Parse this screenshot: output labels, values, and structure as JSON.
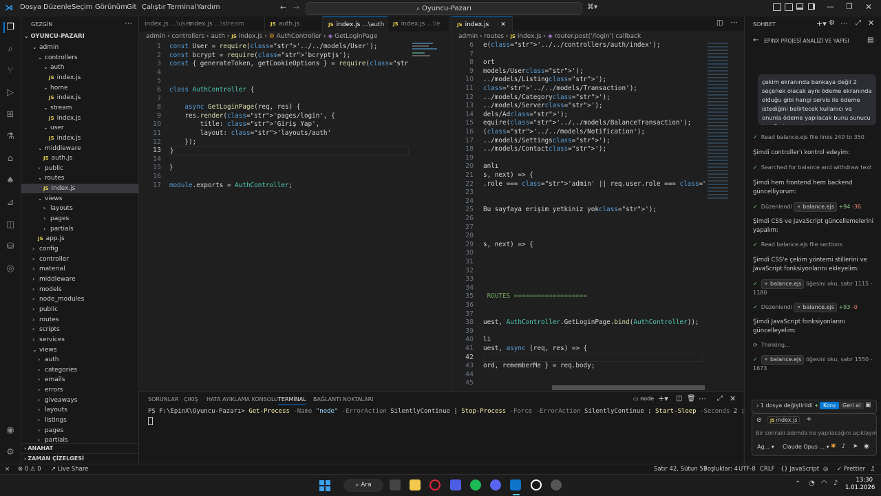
{
  "titlebar": {
    "menu": [
      "Dosya",
      "Düzenle",
      "Seçim",
      "Görünüm",
      "Git",
      "Çalıştır",
      "Terminal",
      "Yardım"
    ],
    "search_text": "Oyuncu-Pazarı"
  },
  "sidebar": {
    "header": "GEZGİN",
    "root": "OYUNCU-PAZARI",
    "tree": [
      {
        "label": "admin",
        "depth": 1,
        "type": "folder-open"
      },
      {
        "label": "controllers",
        "depth": 2,
        "type": "folder-open"
      },
      {
        "label": "auth",
        "depth": 3,
        "type": "folder-open"
      },
      {
        "label": "index.js",
        "depth": 4,
        "type": "file"
      },
      {
        "label": "home",
        "depth": 3,
        "type": "folder-open"
      },
      {
        "label": "index.js",
        "depth": 4,
        "type": "file"
      },
      {
        "label": "stream",
        "depth": 3,
        "type": "folder-open"
      },
      {
        "label": "index.js",
        "depth": 4,
        "type": "file"
      },
      {
        "label": "user",
        "depth": 3,
        "type": "folder-open"
      },
      {
        "label": "index.js",
        "depth": 4,
        "type": "file"
      },
      {
        "label": "middleware",
        "depth": 2,
        "type": "folder-open"
      },
      {
        "label": "auth.js",
        "depth": 3,
        "type": "file"
      },
      {
        "label": "public",
        "depth": 2,
        "type": "folder"
      },
      {
        "label": "routes",
        "depth": 2,
        "type": "folder-open"
      },
      {
        "label": "index.js",
        "depth": 3,
        "type": "file",
        "selected": true
      },
      {
        "label": "views",
        "depth": 2,
        "type": "folder-open"
      },
      {
        "label": "layouts",
        "depth": 3,
        "type": "folder"
      },
      {
        "label": "pages",
        "depth": 3,
        "type": "folder"
      },
      {
        "label": "partials",
        "depth": 3,
        "type": "folder"
      },
      {
        "label": "app.js",
        "depth": 2,
        "type": "file"
      },
      {
        "label": "config",
        "depth": 1,
        "type": "folder"
      },
      {
        "label": "controller",
        "depth": 1,
        "type": "folder"
      },
      {
        "label": "material",
        "depth": 1,
        "type": "folder"
      },
      {
        "label": "middleware",
        "depth": 1,
        "type": "folder"
      },
      {
        "label": "models",
        "depth": 1,
        "type": "folder"
      },
      {
        "label": "node_modules",
        "depth": 1,
        "type": "folder"
      },
      {
        "label": "public",
        "depth": 1,
        "type": "folder"
      },
      {
        "label": "routes",
        "depth": 1,
        "type": "folder"
      },
      {
        "label": "scripts",
        "depth": 1,
        "type": "folder"
      },
      {
        "label": "services",
        "depth": 1,
        "type": "folder"
      },
      {
        "label": "views",
        "depth": 1,
        "type": "folder-open"
      },
      {
        "label": "auth",
        "depth": 2,
        "type": "folder"
      },
      {
        "label": "categories",
        "depth": 2,
        "type": "folder"
      },
      {
        "label": "emails",
        "depth": 2,
        "type": "folder"
      },
      {
        "label": "errors",
        "depth": 2,
        "type": "folder"
      },
      {
        "label": "giveaways",
        "depth": 2,
        "type": "folder"
      },
      {
        "label": "layouts",
        "depth": 2,
        "type": "folder"
      },
      {
        "label": "listings",
        "depth": 2,
        "type": "folder"
      },
      {
        "label": "pages",
        "depth": 2,
        "type": "folder"
      },
      {
        "label": "partials",
        "depth": 2,
        "type": "folder"
      }
    ],
    "outline": "ANAHAT",
    "timeline": "ZAMAN ÇİZELGESİ"
  },
  "editor1": {
    "tabs": [
      {
        "label": "index.js",
        "path": "...\\user"
      },
      {
        "label": "index.js",
        "path": "...\\stream"
      },
      {
        "label": "auth.js",
        "path": ""
      },
      {
        "label": "index.js",
        "path": "...\\auth"
      },
      {
        "label": "index.js",
        "path": "...\\le"
      }
    ],
    "breadcrumb": [
      "admin",
      "controllers",
      "auth",
      "index.js",
      "AuthController",
      "GetLoginPage"
    ],
    "line_numbers": [
      "1",
      "2",
      "3",
      "4",
      "5",
      "6",
      "7",
      "8",
      "9",
      "10",
      "11",
      "12",
      "13",
      "14",
      "15",
      "16",
      "17"
    ],
    "lines": [
      "const User = require('../../models/User');",
      "const bcrypt = require('bcryptjs');",
      "const { generateToken, getCookieOptions } = require('../../../confi",
      "",
      "",
      "class AuthController {",
      "",
      "    async GetLoginPage(req, res) {",
      "    res.render('pages/login', {",
      "        title: 'Giriş Yap',",
      "        layout: 'layouts/auth'",
      "    });",
      "}",
      "",
      "}",
      "",
      "module.exports = AuthController;"
    ]
  },
  "editor2": {
    "tab": "index.js",
    "breadcrumb": [
      "admin",
      "routes",
      "index.js",
      "router.post('/login') callback"
    ],
    "line_numbers": [
      "6",
      "7",
      "8",
      "9",
      "10",
      "11",
      "12",
      "13",
      "14",
      "15",
      "16",
      "17",
      "18",
      "19",
      "20",
      "21",
      "22",
      "23",
      "24",
      "25",
      "26",
      "27",
      "28",
      "29",
      "30",
      "31",
      "32",
      "33",
      "34",
      "35",
      "36",
      "37",
      "38",
      "39",
      "40",
      "41",
      "42",
      "43",
      "44",
      "45"
    ],
    "lines": [
      "e('../../controllers/auth/index');",
      "",
      "ort",
      "models/User');",
      "../models/Listing');",
      "'../../models/Transaction');",
      "../models/Category');",
      "../models/Server');",
      "dels/Ad');",
      "equire('../../models/BalanceTransaction');",
      "('../../models/Notification');",
      "../models/Settings');",
      "../models/Contact');",
      "",
      "anlı",
      "s, next) => {",
      ".role === 'admin' || req.user.role === 'moderator')) {",
      "",
      "",
      "Bu sayfaya erişim yetkiniz yok');",
      "",
      "",
      "",
      "s, next) => {",
      "",
      "",
      "",
      "",
      "",
      " ROUTES ===================",
      "",
      "",
      "uest, AuthController.GetLoginPage.bind(AuthController));",
      "",
      "li",
      "uest, async (req, res) => {",
      "",
      "ord, rememberMe } = req.body;",
      "",
      ""
    ]
  },
  "panel": {
    "tabs": [
      "SORUNLAR",
      "ÇIKIŞ",
      "HATA AYIKLAMA KONSOLU",
      "TERMİNAL",
      "BAĞLANTI NOKTALARI"
    ],
    "active_tab": "TERMİNAL",
    "terminal_name": "node",
    "prompt": "PS F:\\EpinX\\Oyuncu-Pazarı>",
    "command": "Get-Process -Name \"node\" -ErrorAction SilentlyContinue | Stop-Process -Force -ErrorAction SilentlyContinue ; Start-Sleep -Seconds 2 ; node app.js"
  },
  "chat": {
    "header": "SOHBET",
    "session_title": "EPINX PROJESİ ANALİZİ VE YAPISI",
    "user_message": "çekim ekranında bankaya değil 2 seçenek olacak aynı ödeme ekranında olduğu gibi hangi servis ile ödeme istediğini belirtecek kullanıcı ve onunla ödeme yapılacak bunu sunucu taraflı da ayarla",
    "items": [
      {
        "kind": "step",
        "text": "Read balance.ejs file lines 240 to 350"
      },
      {
        "kind": "msg",
        "text": "Şimdi controller'ı kontrol edeyim:"
      },
      {
        "kind": "step",
        "text": "Searched for balance and withdraw text"
      },
      {
        "kind": "msg",
        "text": "Şimdi hem frontend hem backend güncelliyorum:"
      },
      {
        "kind": "edit",
        "label": "Düzenlendi",
        "file": "balance.ejs",
        "add": "+94",
        "del": "-36"
      },
      {
        "kind": "msg",
        "text": "Şimdi CSS ve JavaScript güncellemelerini yapalım:"
      },
      {
        "kind": "step",
        "text": "Read balance.ejs file sections"
      },
      {
        "kind": "msg",
        "text": "Şimdi CSS'e çekim yöntemi stillerini ve JavaScript fonksiyonlarını ekleyelim:"
      },
      {
        "kind": "read",
        "file": "balance.ejs",
        "text": "öğesini oku, satır 1115 - 1180"
      },
      {
        "kind": "edit",
        "label": "Düzenlendi",
        "file": "balance.ejs",
        "add": "+93",
        "del": "-0"
      },
      {
        "kind": "msg",
        "text": "Şimdi JavaScript fonksiyonlarını güncelleyelim:"
      },
      {
        "kind": "thinking",
        "text": "Thinking..."
      },
      {
        "kind": "read",
        "file": "balance.ejs",
        "text": "öğesini oku, satır 1550 - 1673"
      }
    ],
    "changes_text": "1 dosya değiştirildi",
    "changes_add": "+18",
    "keep_label": "Koru",
    "undo_label": "Geri al",
    "attached_file": "index.js",
    "input_placeholder": "Bir sonraki adımda ne yapılacağını açıklayın",
    "agent_label": "Ag...",
    "model_label": "Claude Opus ..."
  },
  "statusbar": {
    "remote": "⨯",
    "problems": "⊗ 0  ⚠ 0",
    "live_share": "Live Share",
    "position": "Satır 42, Sütun 57",
    "spaces": "Boşluklar: 4",
    "encoding": "UTF-8",
    "eol": "CRLF",
    "language": "JavaScript",
    "prettier": "✓ Prettier"
  },
  "taskbar": {
    "search_label": "Ara",
    "time": "13:30",
    "date": "1.01.2026"
  }
}
